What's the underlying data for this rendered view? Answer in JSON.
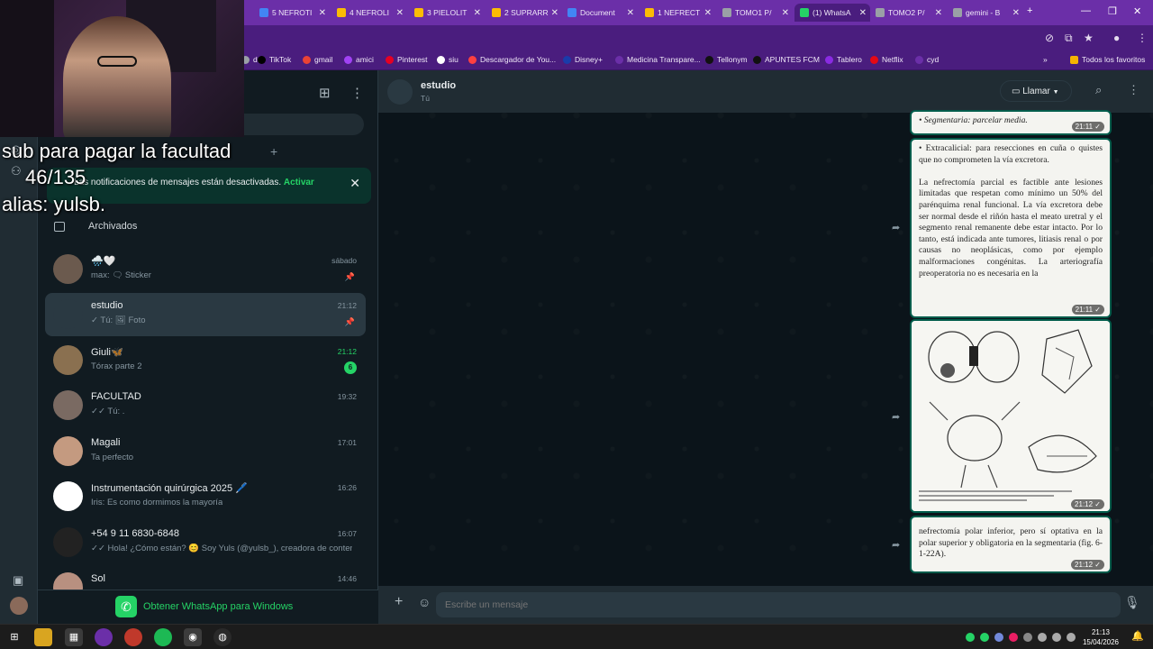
{
  "browser": {
    "tabs": [
      {
        "label": "5 NEFROTI",
        "color": "#4285f4"
      },
      {
        "label": "4 NEFROLI",
        "color": "#fbbc05"
      },
      {
        "label": "3 PIELOLIT",
        "color": "#fbbc05"
      },
      {
        "label": "2 SUPRARR",
        "color": "#fbbc05"
      },
      {
        "label": "Document",
        "color": "#4285f4"
      },
      {
        "label": "1 NEFRECT",
        "color": "#fbbc05"
      },
      {
        "label": "TOMO1 P/",
        "color": "#9aa0a6"
      },
      {
        "label": "(1) WhatsA",
        "color": "#25d366"
      },
      {
        "label": "TOMO2 P/",
        "color": "#9aa0a6"
      },
      {
        "label": "gemini - B",
        "color": "#9aa0a6"
      }
    ],
    "bookmarks": [
      {
        "label": "d",
        "color": "#9aa0a6"
      },
      {
        "label": "TikTok",
        "color": "#000000"
      },
      {
        "label": "gmail",
        "color": "#ea4335"
      },
      {
        "label": "amici",
        "color": "#a142f4"
      },
      {
        "label": "Pinterest",
        "color": "#e60023"
      },
      {
        "label": "siu",
        "color": "#ffffff"
      },
      {
        "label": "Descargador de You...",
        "color": "#ff4040"
      },
      {
        "label": "Disney+",
        "color": "#1a3caa"
      },
      {
        "label": "Medicina Transpare...",
        "color": "#6b2fa8"
      },
      {
        "label": "Tellonym",
        "color": "#111111"
      },
      {
        "label": "APUNTES FCM",
        "color": "#111111"
      },
      {
        "label": "Tablero",
        "color": "#8a2be2"
      },
      {
        "label": "Netflix",
        "color": "#e50914"
      },
      {
        "label": "cyd",
        "color": "#6b2fa8"
      }
    ],
    "all_favorites": "Todos los favoritos"
  },
  "stream": {
    "line1": "sub para pagar la facultad",
    "line2": "46/135",
    "line3": "alias: yulsb."
  },
  "sidebar": {
    "notification": "Las notificaciones de mensajes están desactivadas.",
    "notification_action": "Activar",
    "archived": "Archivados",
    "chats": [
      {
        "name": "🌧️🤍",
        "preview": "max: 🗨 Sticker",
        "time": "sábado",
        "pinned": true,
        "avatar": "#6b5a4e"
      },
      {
        "name": "estudio",
        "preview": "✓ Tú: 🖼 Foto",
        "time": "21:12",
        "pinned": true,
        "avatar": "#2a3942",
        "selected": true
      },
      {
        "name": "Giuli🦋",
        "preview": "Tórax parte 2",
        "time": "21:12",
        "unread": "6",
        "avatar": "#8a7050"
      },
      {
        "name": "FACULTAD",
        "preview": "✓✓ Tú: .",
        "time": "19:32",
        "avatar": "#7a6a62"
      },
      {
        "name": "Magali",
        "preview": "Ta perfecto",
        "time": "17:01",
        "avatar": "#c49a80"
      },
      {
        "name": "Instrumentación quirúrgica 2025 🖊️",
        "preview": "Iris: Es como dormimos la mayoría",
        "time": "16:26",
        "avatar": "#ffffff"
      },
      {
        "name": "+54 9 11 6830-6848",
        "preview": "✓✓ Hola! ¿Cómo están? 😊 Soy Yuls (@yulsb_), creadora de conteni...",
        "time": "16:07",
        "avatar": "#222222"
      },
      {
        "name": "Sol",
        "preview": "",
        "time": "14:46",
        "avatar": "#b89080"
      }
    ],
    "get_whatsapp": "Obtener WhatsApp para Windows"
  },
  "chat": {
    "name": "estudio",
    "subtitle": "Tú",
    "call_label": "Llamar",
    "messages": [
      {
        "text": "• Segmentaria: parcelar media.",
        "time": "21:11 ✓"
      },
      {
        "text": "• Extracalicial: para resecciones en cuña o quistes que no comprometen la vía excretora.\n\nLa nefrectomía parcial es factible ante lesiones limitadas que respetan como mínimo un 50% del parénquima renal funcional. La vía excretora debe ser normal desde el riñón hasta el meato uretral y el segmento renal remanente debe estar intacto. Por lo tanto, está indicada ante tumores, litiasis renal o por causas no neoplásicas, como por ejemplo malformaciones congénitas. La arteriografía preoperatoria no es necesaria en la",
        "time": "21:11 ✓"
      },
      {
        "text": "",
        "time": "21:12 ✓"
      },
      {
        "text": "nefrectomía polar inferior, pero sí optativa en la polar superior y obligatoria en la segmentaria (fig. 6-1-22A).",
        "time": "21:12 ✓"
      }
    ],
    "placeholder": "Escribe un mensaje"
  },
  "taskbar": {
    "time": "21:13",
    "date": "15/04/2026"
  }
}
